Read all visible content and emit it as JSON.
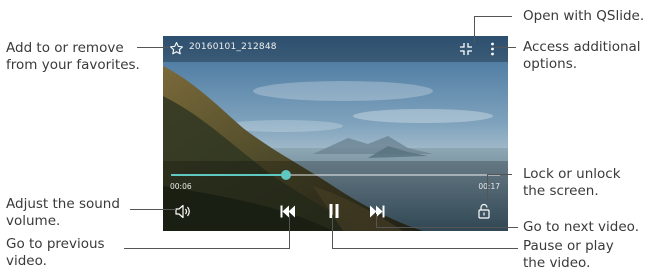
{
  "player": {
    "file_name": "20160101_212848",
    "elapsed": "00:06",
    "duration": "00:17",
    "progress": 0.35,
    "accent_color": "#5fc8c0",
    "icons": {
      "favorite": "star-outline-icon",
      "qslide": "qslide-icon",
      "more": "more-vertical-icon",
      "volume": "volume-icon",
      "previous": "skip-previous-icon",
      "pause": "pause-icon",
      "next": "skip-next-icon",
      "lock": "lock-icon"
    }
  },
  "callouts": {
    "favorites": [
      "Add to or remove",
      "from your favorites."
    ],
    "qslide": [
      "Open with QSlide."
    ],
    "options": [
      "Access additional",
      "options."
    ],
    "lock": [
      "Lock or unlock",
      "the screen."
    ],
    "volume": [
      "Adjust the sound",
      "volume."
    ],
    "previous": [
      "Go to previous",
      "video."
    ],
    "next": [
      "Go to next video."
    ],
    "pause": [
      "Pause or play",
      "the video."
    ]
  }
}
